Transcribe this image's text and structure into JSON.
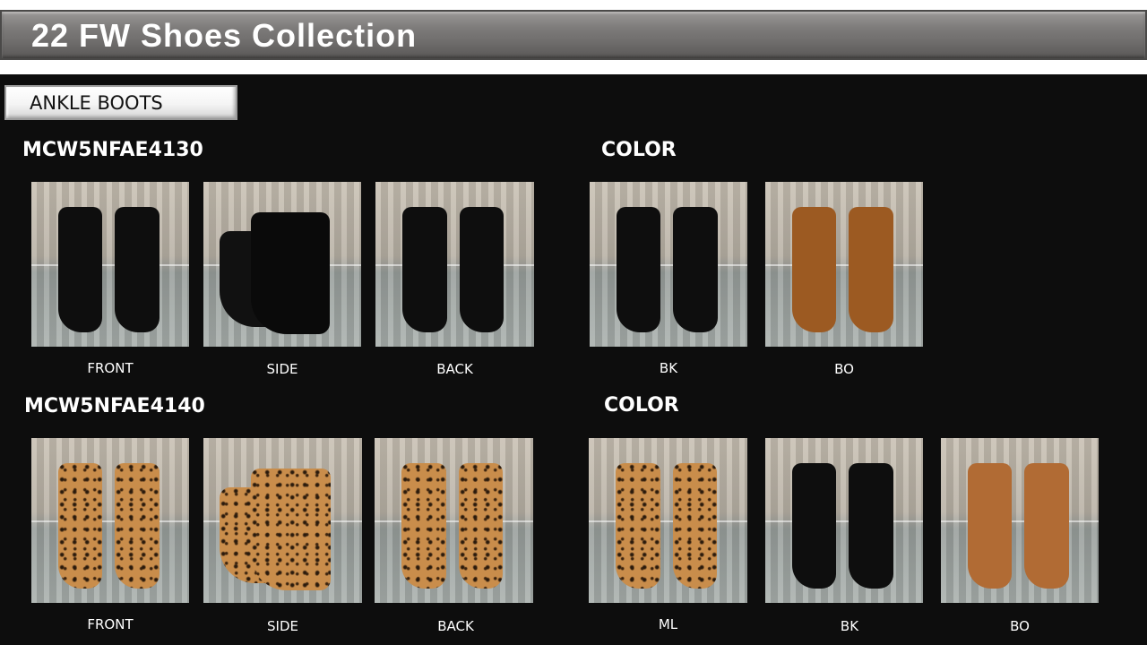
{
  "title": "22 FW Shoes Collection",
  "category": "ANKLE BOOTS",
  "products": [
    {
      "code": "MCW5NFAE4130",
      "color_heading": "COLOR",
      "views": [
        "FRONT",
        "SIDE",
        "BACK"
      ],
      "colors": [
        "BK",
        "BO"
      ]
    },
    {
      "code": "MCW5NFAE4140",
      "color_heading": "COLOR",
      "views": [
        "FRONT",
        "SIDE",
        "BACK"
      ],
      "colors": [
        "ML",
        "BK",
        "BO"
      ]
    }
  ],
  "palette": {
    "black_leather": "#0e0e0e",
    "brown_leather": "#9c5a22",
    "tan_leather": "#b16b34",
    "leopard": "#c98d4b"
  }
}
